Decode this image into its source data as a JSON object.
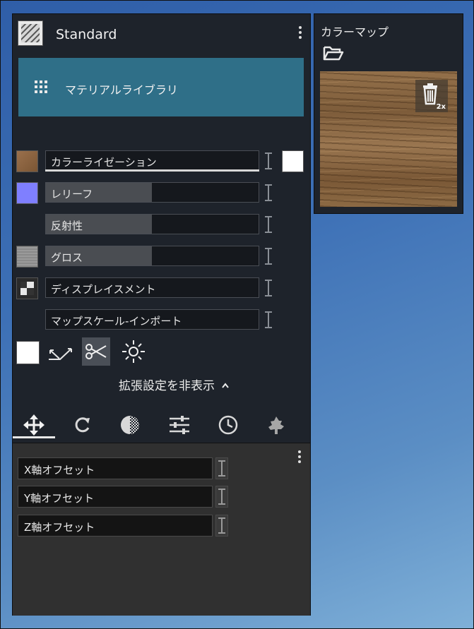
{
  "header": {
    "title": "Standard"
  },
  "library": {
    "label": "マテリアルライブラリ"
  },
  "channels": [
    {
      "label": "カラーライゼーション",
      "swatch": "#8a6443",
      "fill": 0
    },
    {
      "label": "レリーフ",
      "swatch": "#7f7fff",
      "fill": 0.5
    },
    {
      "label": "反射性",
      "swatch": "",
      "fill": 0.5
    },
    {
      "label": "グロス",
      "swatch": "#8c8c8c",
      "fill": 0.5
    },
    {
      "label": "ディスプレイスメント",
      "swatch": "checker",
      "fill": 0
    },
    {
      "label": "マップスケール-インポート",
      "swatch": "",
      "fill": 0
    }
  ],
  "advanced": {
    "toggle_label": "拡張設定を非表示"
  },
  "tabs": [
    "move-icon",
    "rotate-icon",
    "contrast-icon",
    "sliders-icon",
    "clock-icon",
    "tree-icon"
  ],
  "offsets": [
    {
      "label": "X軸オフセット"
    },
    {
      "label": "Y軸オフセット"
    },
    {
      "label": "Z軸オフセット"
    }
  ],
  "color_map": {
    "title": "カラーマップ",
    "multiplier": "2x"
  },
  "colors": {
    "accent": "#2f6f88",
    "panel": "#1e232b",
    "subpanel": "#303030"
  }
}
